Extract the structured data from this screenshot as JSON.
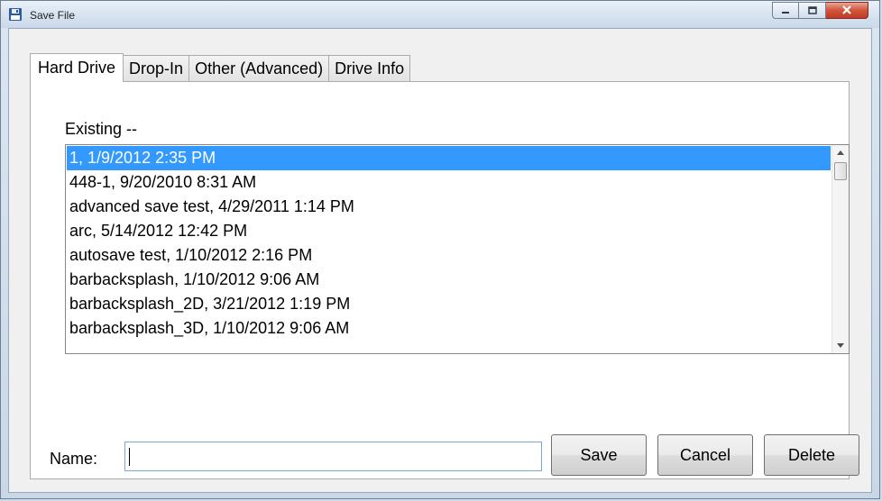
{
  "window": {
    "title": "Save File"
  },
  "tabs": [
    {
      "label": "Hard Drive",
      "active": true
    },
    {
      "label": "Drop-In",
      "active": false
    },
    {
      "label": "Other (Advanced)",
      "active": false
    },
    {
      "label": "Drive Info",
      "active": false
    }
  ],
  "existing": {
    "label": "Existing --",
    "items": [
      "1, 1/9/2012 2:35 PM",
      "448-1, 9/20/2010 8:31 AM",
      "advanced save test, 4/29/2011 1:14 PM",
      "arc, 5/14/2012 12:42 PM",
      "autosave test, 1/10/2012 2:16 PM",
      "barbacksplash, 1/10/2012 9:06 AM",
      "barbacksplash_2D, 3/21/2012 1:19 PM",
      "barbacksplash_3D, 1/10/2012 9:06 AM"
    ],
    "selected_index": 0
  },
  "name": {
    "label": "Name:",
    "value": ""
  },
  "buttons": {
    "save": "Save",
    "cancel": "Cancel",
    "delete": "Delete"
  },
  "icons": {
    "title": "floppy-disk-icon",
    "minimize": "minimize-icon",
    "maximize": "maximize-icon",
    "close": "close-icon",
    "scroll_up": "scroll-up-arrow-icon",
    "scroll_down": "scroll-down-arrow-icon"
  },
  "colors": {
    "selection": "#3399ff",
    "close_button": "#c74a33"
  }
}
